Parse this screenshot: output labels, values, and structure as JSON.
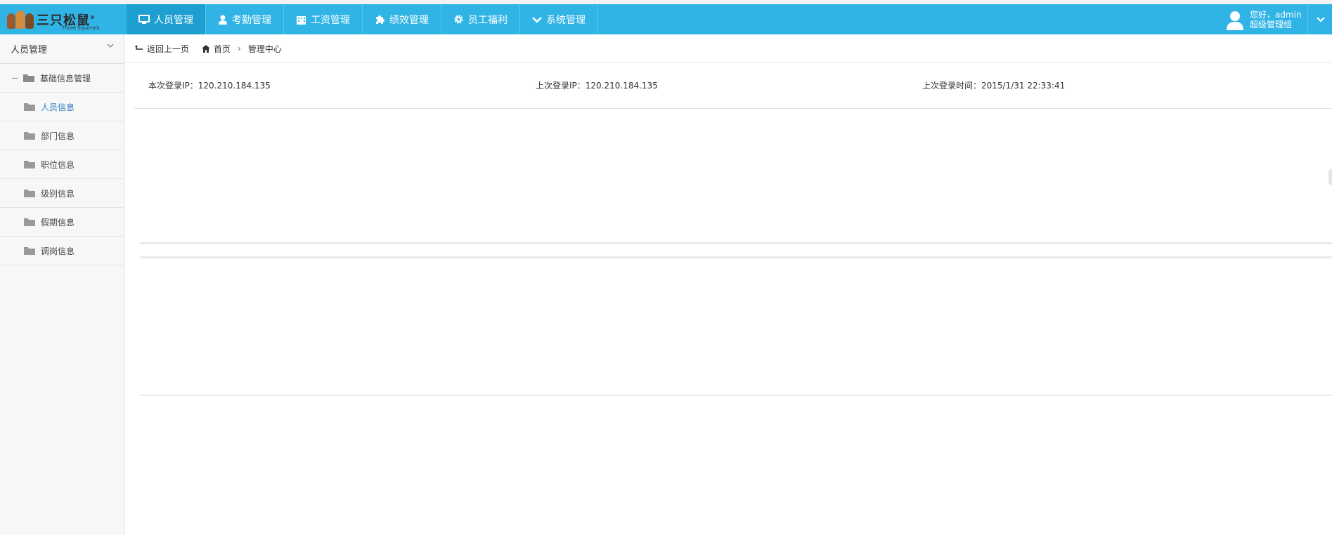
{
  "app": {
    "brand": "三只松鼠",
    "brand_sub": "Three Squirrels"
  },
  "topnav": {
    "items": [
      {
        "label": "人员管理",
        "icon": "monitor-icon",
        "active": true
      },
      {
        "label": "考勤管理",
        "icon": "user-icon",
        "active": false
      },
      {
        "label": "工资管理",
        "icon": "building-icon",
        "active": false
      },
      {
        "label": "绩效管理",
        "icon": "puzzle-icon",
        "active": false
      },
      {
        "label": "员工福利",
        "icon": "gear-icon",
        "active": false
      },
      {
        "label": "系统管理",
        "icon": "chevron-down-icon",
        "active": false
      }
    ]
  },
  "user": {
    "greeting": "您好，admin",
    "role": "超级管理组"
  },
  "sidebar": {
    "header": "人员管理",
    "group": "基础信息管理",
    "items": [
      {
        "label": "人员信息",
        "active": true
      },
      {
        "label": "部门信息",
        "active": false
      },
      {
        "label": "职位信息",
        "active": false
      },
      {
        "label": "级别信息",
        "active": false
      },
      {
        "label": "假期信息",
        "active": false
      },
      {
        "label": "调岗信息",
        "active": false
      }
    ]
  },
  "breadcrumb": {
    "back": "返回上一页",
    "home": "首页",
    "current": "管理中心"
  },
  "login": {
    "this_ip": "本次登录IP：120.210.184.135",
    "last_ip": "上次登录IP：120.210.184.135",
    "last_time": "上次登录时间：2015/1/31 22:33:41"
  },
  "colors": {
    "topbar": "#30b4e6",
    "nav_active": "#1e9fd2",
    "link_blue": "#2a7ec2"
  }
}
